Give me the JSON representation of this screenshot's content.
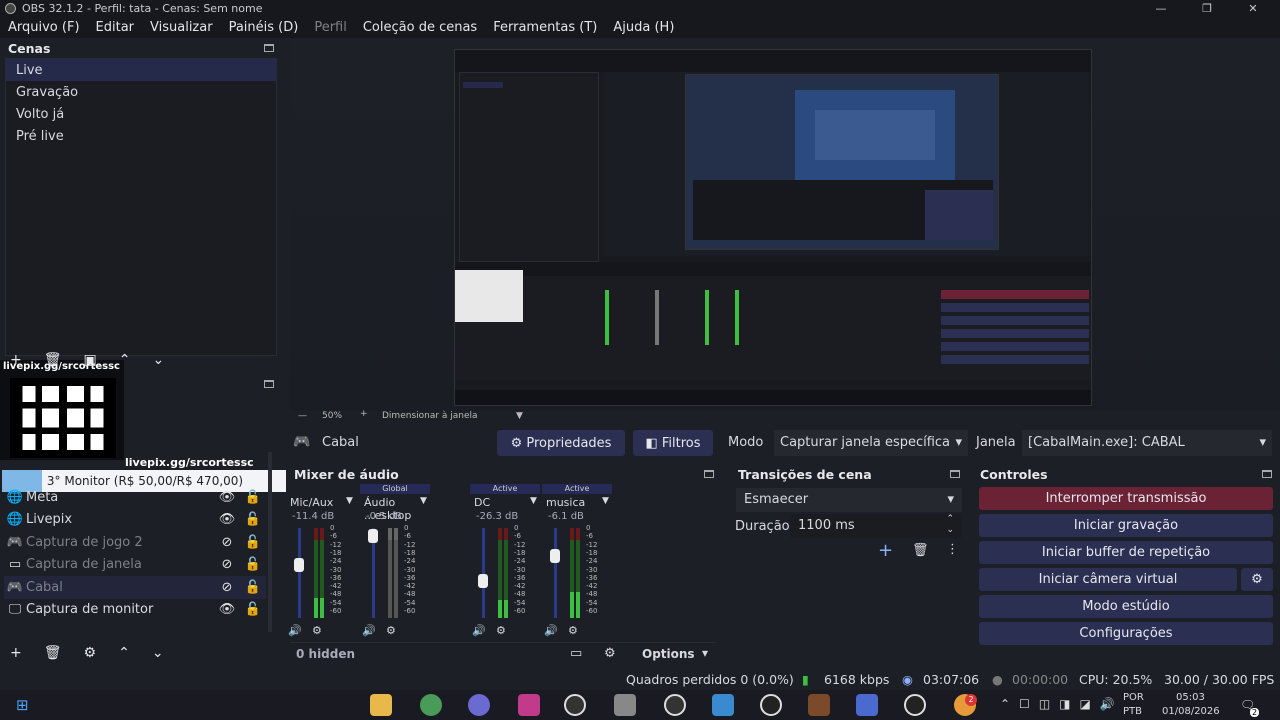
{
  "window": {
    "title": "OBS 32.1.2 - Perfil: tata - Cenas: Sem nome",
    "min": "—",
    "max": "❐",
    "close": "✕"
  },
  "menu": [
    "Arquivo (F)",
    "Editar",
    "Visualizar",
    "Painéis (D)",
    "Perfil",
    "Coleção de cenas",
    "Ferramentas (T)",
    "Ajuda (H)"
  ],
  "scenes": {
    "title": "Cenas",
    "items": [
      "Live",
      "Gravação",
      "Volto já",
      "Pré live"
    ]
  },
  "overlay": {
    "qr_label": "livepix.gg/srcortessc",
    "qr_label2": "livepix.gg/srcortessc",
    "monitor": "3° Monitor (R$ 50,00/R$ 470,00)"
  },
  "sources": {
    "items": [
      {
        "icon": "globe-icon",
        "glyph": "🌐",
        "name": "Meta",
        "vis": "eye",
        "lock": true
      },
      {
        "icon": "globe-icon",
        "glyph": "🌐",
        "name": "Livepix",
        "vis": "eye",
        "lock": true
      },
      {
        "icon": "gamepad-icon",
        "glyph": "🎮",
        "name": "Captura de jogo 2",
        "vis": "eye-off",
        "lock": true,
        "dim": true
      },
      {
        "icon": "window-icon",
        "glyph": "▭",
        "name": "Captura de janela",
        "vis": "eye-off",
        "lock": true,
        "dim": true
      },
      {
        "icon": "gamepad-icon",
        "glyph": "🎮",
        "name": "Cabal",
        "vis": "eye-off",
        "lock": true,
        "dim": true
      },
      {
        "icon": "monitor-icon",
        "glyph": "🖵",
        "name": "Captura de monitor",
        "vis": "eye",
        "lock": true
      }
    ]
  },
  "preview_bar": {
    "zoom": "50%",
    "fit": "Dimensionar à janela"
  },
  "props_bar": {
    "source": "Cabal",
    "properties": "Propriedades",
    "filters": "Filtros",
    "mode_label": "Modo",
    "mode_value": "Capturar janela específica",
    "window_label": "Janela",
    "window_value": "[CabalMain.exe]: CABAL"
  },
  "mixer": {
    "title": "Mixer de áudio",
    "hidden": "0 hidden",
    "options": "Options",
    "channels": [
      {
        "name": "Mic/Aux",
        "db": "-11.4 dB",
        "badge": "",
        "level": 0.45,
        "fader": 0.6,
        "muted": false
      },
      {
        "name": "Áudio ...esktop",
        "db": "-0.5 dB",
        "badge": "Global",
        "level": 0.0,
        "fader": 0.92,
        "muted": true
      },
      {
        "name": "DC",
        "db": "-26.3 dB",
        "badge": "Active",
        "level": 0.5,
        "fader": 0.42,
        "muted": false
      },
      {
        "name": "musica",
        "db": "-6.1 dB",
        "badge": "Active",
        "level": 0.28,
        "fader": 0.7,
        "muted": false
      }
    ],
    "scale": [
      "0",
      "-6",
      "-12",
      "-18",
      "-24",
      "-30",
      "-36",
      "-42",
      "-48",
      "-54",
      "-60"
    ]
  },
  "transitions": {
    "title": "Transições de cena",
    "type": "Esmaecer",
    "duration_label": "Duração",
    "duration": "1100 ms"
  },
  "controls": {
    "title": "Controles",
    "buttons": [
      "Interromper transmissão",
      "Iniciar gravação",
      "Iniciar buffer de repetição",
      "Iniciar câmera virtual",
      "Modo estúdio",
      "Configurações"
    ]
  },
  "status": {
    "dropped": "Quadros perdidos 0 (0.0%)",
    "kbps": "6168 kbps",
    "stream_time": "03:07:06",
    "rec_time": "00:00:00",
    "cpu": "CPU: 20.5%",
    "fps": "30.00 / 30.00 FPS"
  },
  "taskbar": {
    "lang1": "POR",
    "lang2": "PTB",
    "time": "05:03",
    "date": "01/08/2026",
    "notif": "2",
    "badge": "2"
  },
  "colors": {
    "accent": "#2b2f52",
    "stop": "#6b2235",
    "meter_green": "#3fbf3f"
  }
}
